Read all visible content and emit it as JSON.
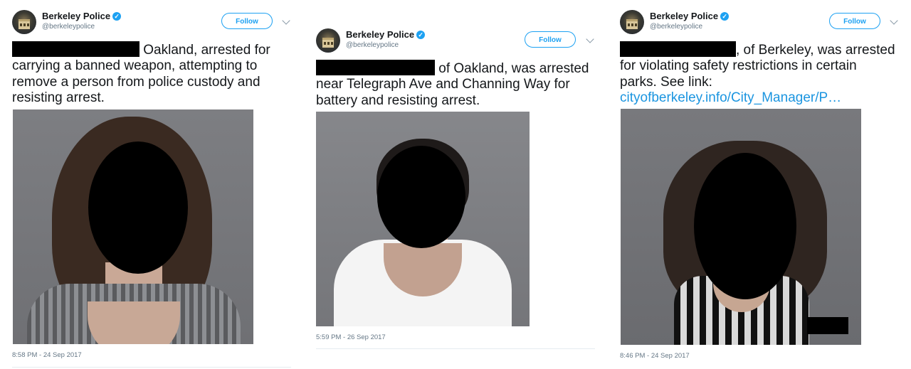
{
  "tweets": [
    {
      "name": "Berkeley Police",
      "handle": "@berkeleypolice",
      "follow_label": "Follow",
      "lines": [
        "Oakland, arrested for",
        "carrying a banned weapon, attempting to",
        "remove a person from police custody and",
        "resisting arrest."
      ],
      "timestamp": "8:58 PM - 24 Sep 2017"
    },
    {
      "name": "Berkeley Police",
      "handle": "@berkeleypolice",
      "follow_label": "Follow",
      "lines": [
        "of Oakland, was arrested",
        "near Telegraph Ave and Channing Way for",
        "battery and resisting arrest."
      ],
      "timestamp": "5:59 PM - 26 Sep 2017"
    },
    {
      "name": "Berkeley Police",
      "handle": "@berkeleypolice",
      "follow_label": "Follow",
      "lines": [
        ", of Berkeley, was arrested",
        "for violating safety restrictions in certain",
        "parks. See link:"
      ],
      "link": "cityofberkeley.info/City_Manager/P…",
      "timestamp": "8:46 PM - 24 Sep 2017"
    }
  ],
  "icons": {
    "verified": "verified-badge-icon",
    "caret": "chevron-down-icon"
  },
  "colors": {
    "accent": "#1da1f2",
    "link": "#1b95e0",
    "muted": "#657786",
    "redaction": "#000000"
  }
}
